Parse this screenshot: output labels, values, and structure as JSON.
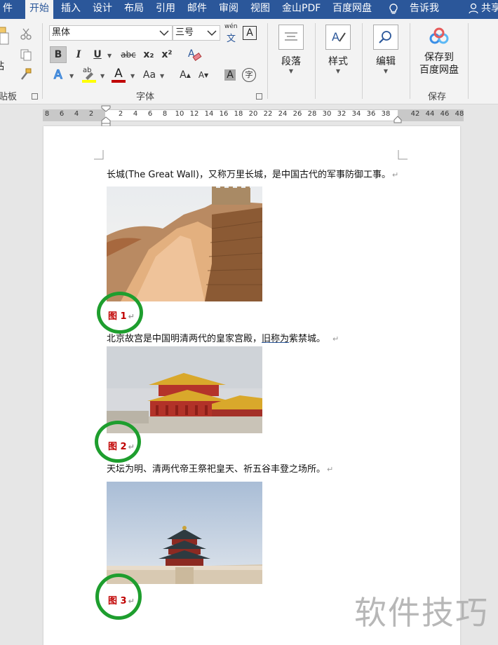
{
  "tabs": [
    {
      "label": "件",
      "active": false
    },
    {
      "label": "开始",
      "active": true
    },
    {
      "label": "插入",
      "active": false
    },
    {
      "label": "设计",
      "active": false
    },
    {
      "label": "布局",
      "active": false
    },
    {
      "label": "引用",
      "active": false
    },
    {
      "label": "邮件",
      "active": false
    },
    {
      "label": "审阅",
      "active": false
    },
    {
      "label": "视图",
      "active": false
    },
    {
      "label": "金山PDF",
      "active": false
    },
    {
      "label": "百度网盘",
      "active": false
    },
    {
      "label": "告诉我",
      "active": false
    }
  ],
  "share_label": "共享",
  "ribbon": {
    "clipboard": {
      "paste_label": "贴",
      "group_label": "贴板"
    },
    "font": {
      "font_name": "黑体",
      "font_size": "三号",
      "phonetic_label": "wén",
      "group_label": "字体",
      "bold": "B",
      "italic": "I",
      "underline": "U",
      "strike": "abc",
      "subscript": "x₂",
      "superscript": "x²",
      "font_color_label": "A",
      "case_label": "Aa",
      "grow_label": "A",
      "shrink_label": "A",
      "char_shade_label": "A",
      "enclose_label": "字",
      "highlight_label": "ab"
    },
    "paragraph": {
      "label": "段落"
    },
    "styles": {
      "label": "样式"
    },
    "editing": {
      "label": "编辑"
    },
    "save": {
      "line1": "保存到",
      "line2": "百度网盘",
      "group_label": "保存"
    },
    "colors": {
      "accent": "#2b579a",
      "font_red": "#c00000",
      "highlight_yellow": "#ffff00"
    }
  },
  "ruler": {
    "numbers": [
      "8",
      "6",
      "4",
      "2",
      "2",
      "4",
      "6",
      "8",
      "10",
      "12",
      "14",
      "16",
      "18",
      "20",
      "22",
      "24",
      "26",
      "28",
      "30",
      "32",
      "34",
      "36",
      "38",
      "42",
      "44",
      "46",
      "48"
    ]
  },
  "document": {
    "para1": "长城(The Great Wall)，又称万里长城，是中国古代的军事防御工事。",
    "caption1": "图 1",
    "para2_start": "北京故宫是中国明清两代的皇家宫殿，",
    "para2_link": "旧称为",
    "para2_end": "紫禁城。",
    "caption2": "图 2",
    "para3": "天坛为明、清两代帝王祭祀皇天、祈五谷丰登之场所。",
    "caption3": "图 3",
    "return_mark": "↵",
    "highlight_color": "#1e9e2e"
  },
  "watermark": "软件技巧"
}
